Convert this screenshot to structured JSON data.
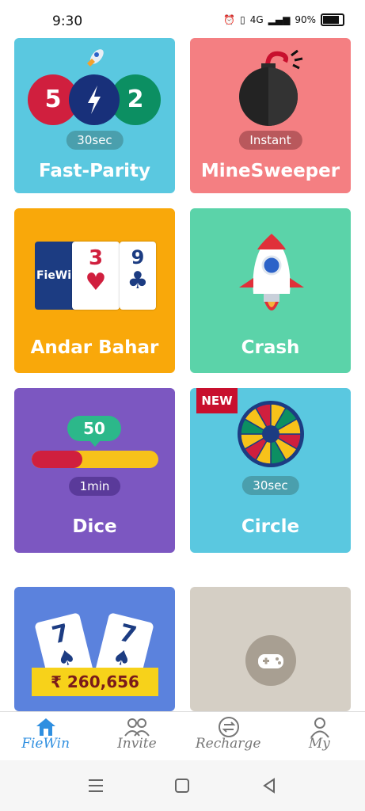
{
  "status_bar": {
    "time": "9:30",
    "network": "4G",
    "battery": "90%"
  },
  "games": [
    {
      "name": "Fast-Parity",
      "tag": "30sec",
      "color": "#5ac8e0",
      "numbers": [
        "5",
        "2"
      ]
    },
    {
      "name": "MineSweeper",
      "tag": "Instant",
      "color": "#f47f82"
    },
    {
      "name": "Andar Bahar",
      "color": "#f9a80a",
      "brand_card": "FieWin",
      "card_values": [
        "3",
        "9"
      ]
    },
    {
      "name": "Crash",
      "color": "#5bd3a9"
    },
    {
      "name": "Dice",
      "tag": "1min",
      "color": "#7c57c1",
      "value": "50",
      "progress": 0.4
    },
    {
      "name": "Circle",
      "tag": "30sec",
      "color": "#5ac8e0",
      "badge": "NEW"
    },
    {
      "name": "",
      "color": "#5b82dd",
      "card_values": [
        "7",
        "7"
      ],
      "jackpot": "₹ 260,656"
    },
    {
      "name": "",
      "color": "#d5cfc5"
    }
  ],
  "nav": {
    "items": [
      {
        "label": "FieWin",
        "active": true
      },
      {
        "label": "Invite",
        "active": false
      },
      {
        "label": "Recharge",
        "active": false
      },
      {
        "label": "My",
        "active": false
      }
    ],
    "active_color": "#2f8fe0",
    "inactive_color": "#777777"
  }
}
